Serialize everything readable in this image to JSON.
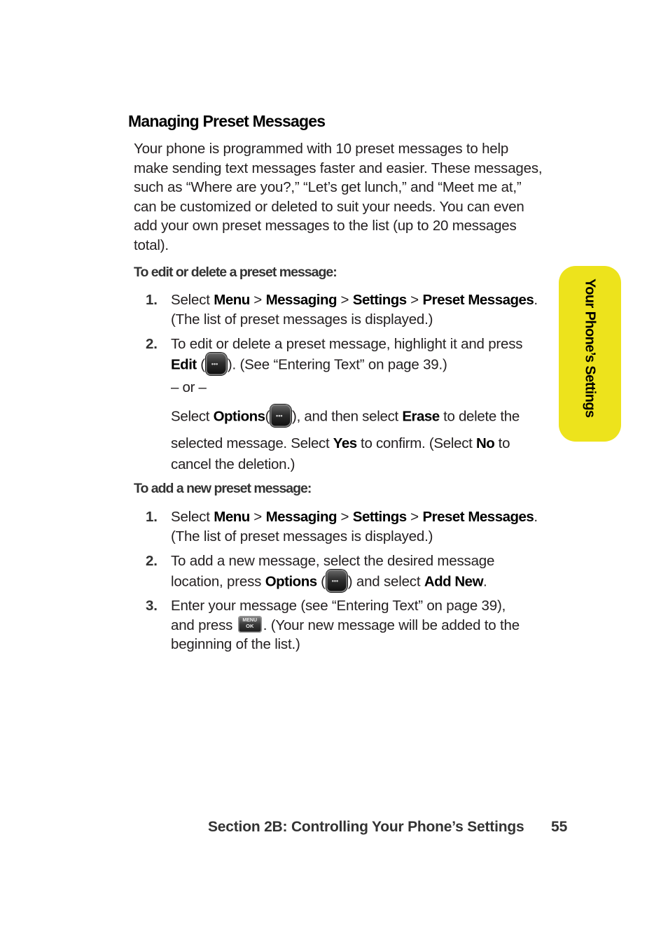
{
  "heading": "Managing Preset Messages",
  "intro_lines": [
    "Your phone is programmed with 10 preset messages to help",
    "make sending text messages faster and easier. These messages,",
    "such as “Where are you?,” “Let’s get lunch,” and “Meet me at,”",
    "can be customized or deleted to suit your needs. You can even",
    "add your own preset messages to the list (up to 20 messages",
    "total)."
  ],
  "edit_section": {
    "subheading": "To edit or delete a preset message:",
    "step1": {
      "num": "1.",
      "select": "Select ",
      "menu": "Menu",
      "sep": " > ",
      "messaging": "Messaging",
      "settings": "Settings",
      "preset": "Preset Messages",
      "period": ".",
      "line2": "(The list of preset messages is displayed.)"
    },
    "step2": {
      "num": "2.",
      "line1": "To edit or delete a preset message, highlight it and press",
      "edit": "Edit",
      "open_paren": " (",
      "after_icon": "). (See “Entering Text” on page 39.)",
      "or": "– or –",
      "select": "Select ",
      "options": "Options",
      "after_options": "), and then select ",
      "erase": "Erase",
      "after_erase": " to delete the",
      "line4a": "selected message. Select ",
      "yes": "Yes",
      "line4b": " to confirm. (Select ",
      "no": "No",
      "line4c": " to",
      "line5": "cancel the deletion.)"
    }
  },
  "add_section": {
    "subheading": "To add a new preset message:",
    "step1": {
      "num": "1.",
      "select": "Select ",
      "menu": "Menu",
      "sep": " > ",
      "messaging": "Messaging",
      "settings": "Settings",
      "preset": "Preset Messages",
      "period": ".",
      "line2": "(The list of preset messages is displayed.)"
    },
    "step2": {
      "num": "2.",
      "line1": "To add a new message, select the desired message",
      "line2a": "location, press ",
      "options": "Options",
      "open_paren": " (",
      "line2b": ") and select ",
      "add_new": "Add New",
      "period": "."
    },
    "step3": {
      "num": "3.",
      "line1": "Enter your message (see “Entering Text” on page 39),",
      "line2a": "and press ",
      "line2b": ". (Your new message will be added to the",
      "line3": "beginning of the list.)"
    }
  },
  "icons": {
    "softkey": "softkey-dots-icon",
    "menu_ok": {
      "top": "MENU",
      "bottom": "OK"
    },
    "softkey_dots": "•••"
  },
  "side_tab": {
    "label": "Your Phone’s Settings",
    "color": "#ede31c"
  },
  "footer": {
    "section": "Section 2B: Controlling Your Phone’s Settings",
    "page_number": "55"
  }
}
